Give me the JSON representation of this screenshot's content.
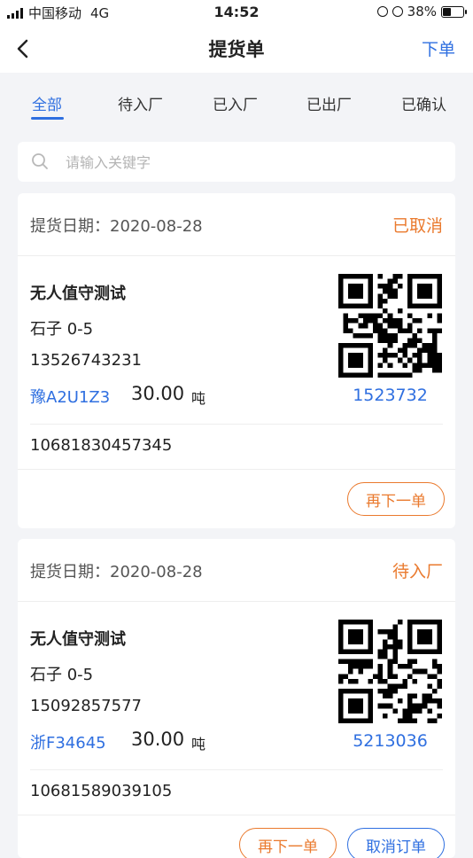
{
  "status_bar": {
    "carrier": "中国移动",
    "network": "4G",
    "time": "14:52",
    "battery": "38%"
  },
  "nav": {
    "title": "提货单",
    "action": "下单"
  },
  "tabs": [
    "全部",
    "待入厂",
    "已入厂",
    "已出厂",
    "已确认"
  ],
  "active_tab": "全部",
  "search": {
    "placeholder": "请输入关键字"
  },
  "colors": {
    "accent": "#2f6fe0",
    "status_orange": "#ea7a2e",
    "background": "#f3f4f7"
  },
  "orders": [
    {
      "date_label": "提货日期：",
      "date": "2020-08-28",
      "status": "已取消",
      "name": "无人值守测试",
      "goods": "石子 0-5",
      "phone": "13526743231",
      "plate": "豫A2U1Z3",
      "weight": "30.00",
      "unit": "吨",
      "qr_code": "1523732",
      "order_no": "10681830457345",
      "buttons": [
        "再下一单"
      ]
    },
    {
      "date_label": "提货日期：",
      "date": "2020-08-28",
      "status": "待入厂",
      "name": "无人值守测试",
      "goods": "石子 0-5",
      "phone": "15092857577",
      "plate": "浙F34645",
      "weight": "30.00",
      "unit": "吨",
      "qr_code": "5213036",
      "order_no": "10681589039105",
      "buttons": [
        "再下一单",
        "取消订单"
      ]
    }
  ]
}
